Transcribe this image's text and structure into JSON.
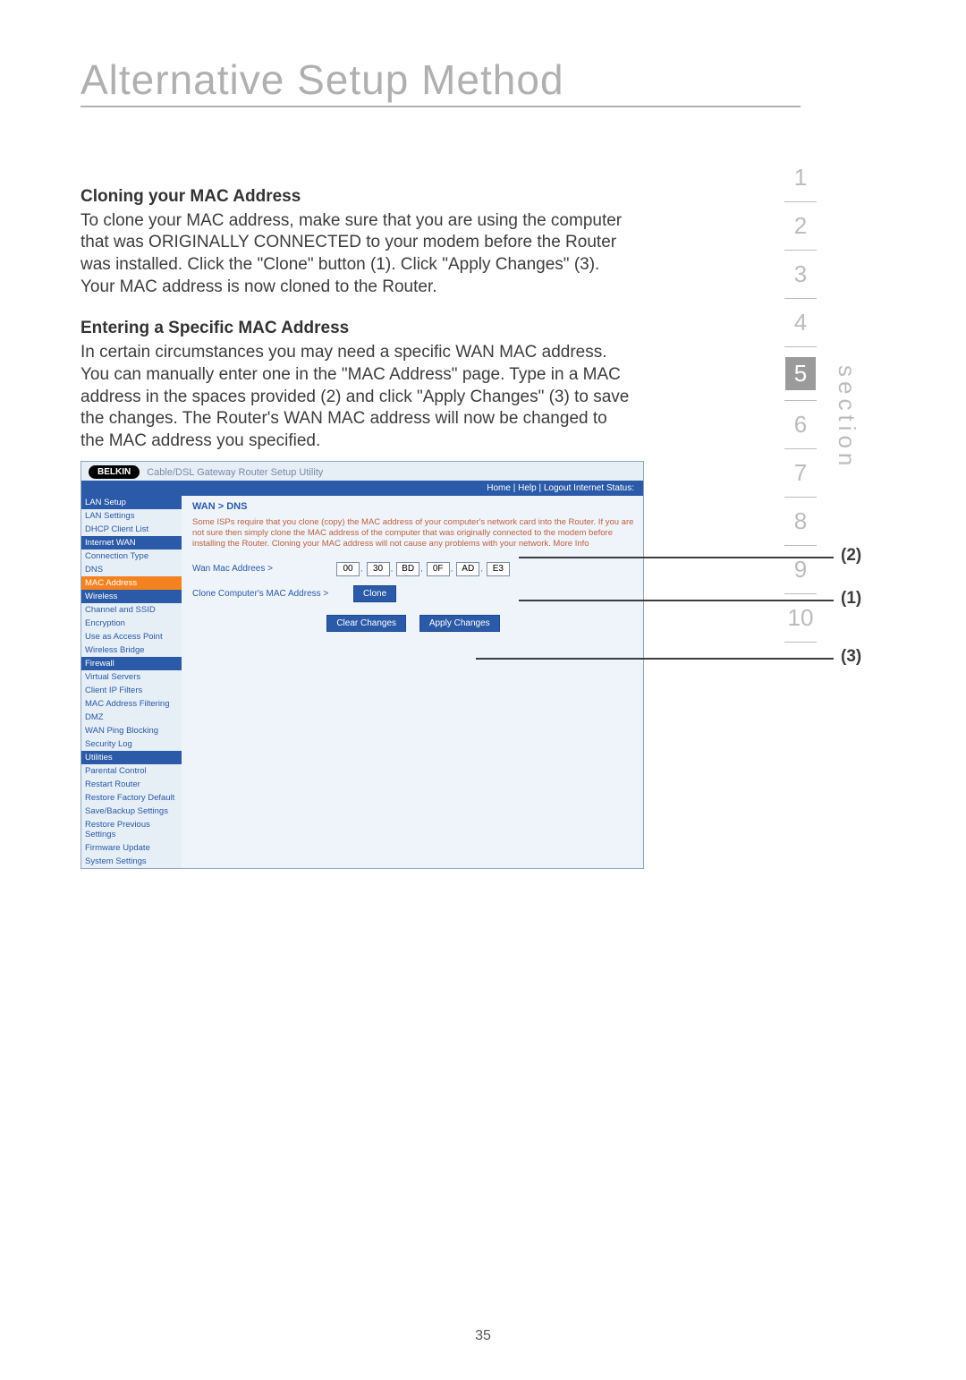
{
  "page_title": "Alternative Setup Method",
  "section_label": "section",
  "nav_numbers": [
    "1",
    "2",
    "3",
    "4",
    "5",
    "6",
    "7",
    "8",
    "9",
    "10"
  ],
  "nav_active": "5",
  "h1": "Cloning your MAC Address",
  "p1": "To clone your MAC address, make sure that you are using the computer that was ORIGINALLY CONNECTED to your modem before the Router was installed. Click the \"Clone\" button (1). Click \"Apply Changes\" (3). Your MAC address is now cloned to the Router.",
  "h2": "Entering a Specific MAC Address",
  "p2": "In certain circumstances you may need a specific WAN MAC address. You can manually enter one in the \"MAC Address\" page. Type in a MAC address in the spaces provided (2) and click \"Apply Changes\" (3) to save the changes. The Router's WAN MAC address will now be changed to the MAC address you specified.",
  "callouts": {
    "c1": "(1)",
    "c2": "(2)",
    "c3": "(3)"
  },
  "page_number": "35",
  "screenshot": {
    "logo": "BELKIN",
    "product": "Cable/DSL Gateway Router Setup Utility",
    "top_links": "Home | Help | Logout    Internet Status:",
    "breadcrumb": "WAN > DNS",
    "description": "Some ISPs require that you clone (copy) the MAC address of your computer's network card into the Router. If you are not sure then simply clone the MAC address of the computer that was originally connected to the modem before installing the Router. Cloning your MAC address will not cause any problems with your network. More Info",
    "mac_label": "Wan Mac Addrees >",
    "mac_values": [
      "00",
      "30",
      "BD",
      "0F",
      "AD",
      "E3"
    ],
    "clone_label": "Clone Computer's MAC Address >",
    "clone_btn": "Clone",
    "clear_btn": "Clear Changes",
    "apply_btn": "Apply Changes",
    "sidebar": {
      "cat1": "LAN Setup",
      "i1": "LAN Settings",
      "i2": "DHCP Client List",
      "cat2": "Internet WAN",
      "i3": "Connection Type",
      "i4": "DNS",
      "i5": "MAC Address",
      "cat3": "Wireless",
      "i6": "Channel and SSID",
      "i7": "Encryption",
      "i8": "Use as Access Point",
      "i9": "Wireless Bridge",
      "cat4": "Firewall",
      "i10": "Virtual Servers",
      "i11": "Client IP Filters",
      "i12": "MAC Address Filtering",
      "i13": "DMZ",
      "i14": "WAN Ping Blocking",
      "i15": "Security Log",
      "cat5": "Utilities",
      "i16": "Parental Control",
      "i17": "Restart Router",
      "i18": "Restore Factory Default",
      "i19": "Save/Backup Settings",
      "i20": "Restore Previous Settings",
      "i21": "Firmware Update",
      "i22": "System Settings"
    }
  }
}
